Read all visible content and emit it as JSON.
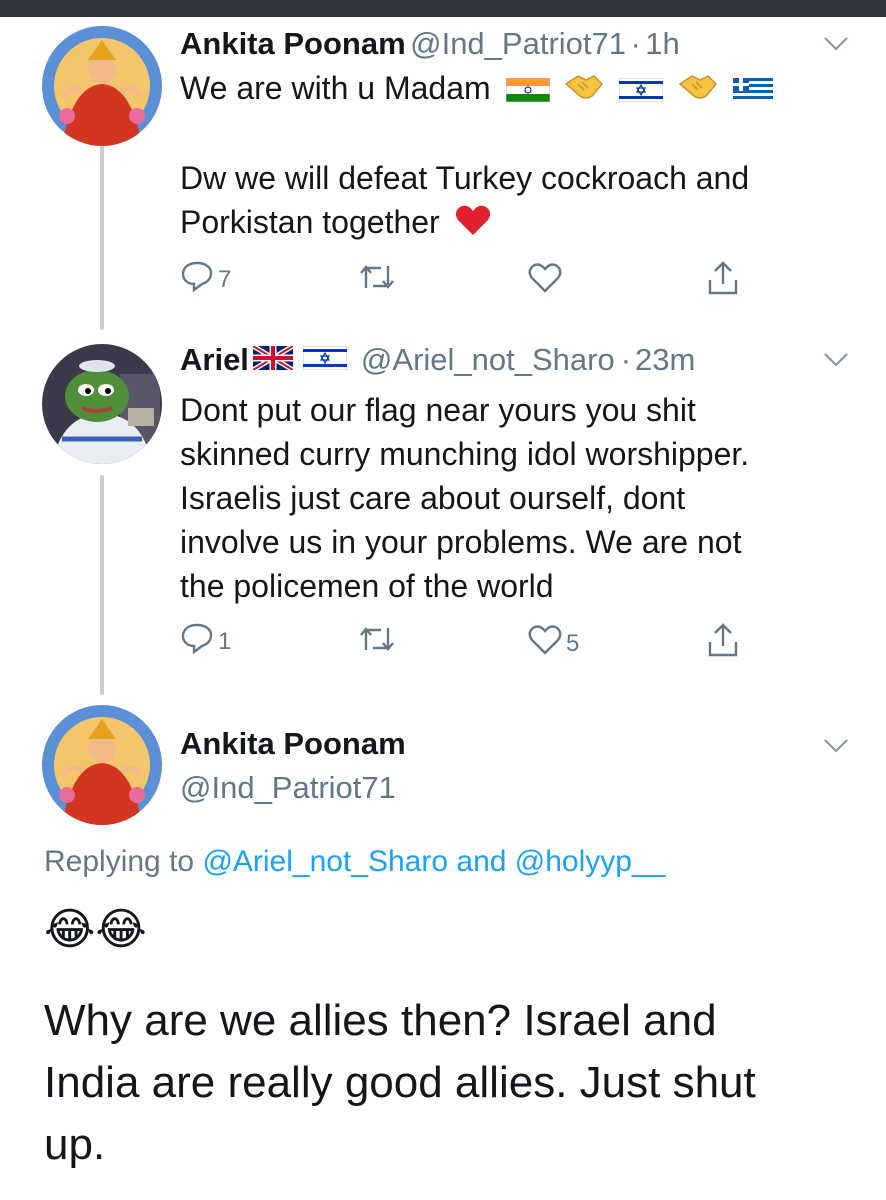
{
  "tweets": [
    {
      "display_name": "Ankita Poonam",
      "handle": "@Ind_Patriot71",
      "sep": "·",
      "time": "1h",
      "line1": "We are with u Madam",
      "line2": "Dw we will defeat Turkey cockroach and",
      "line3": "Porkistan together",
      "reply_count": "7",
      "retweet_count": "",
      "like_count": "",
      "icon": "heart-emoji"
    },
    {
      "display_name": "Ariel",
      "handle": "@Ariel_not_Sharo",
      "sep": "·",
      "time": "23m",
      "lines": [
        "Dont put our flag near yours you shit",
        "skinned curry munching idol worshipper.",
        "Israelis just care about ourself, dont",
        "involve us in your problems. We are not",
        "the policemen of the world"
      ],
      "reply_count": "1",
      "retweet_count": "",
      "like_count": "5"
    }
  ],
  "main_tweet": {
    "display_name": "Ankita Poonam",
    "handle": "@Ind_Patriot71",
    "replying_prefix": "Replying to",
    "replying_user1": "@Ariel_not_Sharo",
    "replying_and": "and",
    "replying_user2": "@holyyp__",
    "emoji": "😂😂",
    "lines": [
      "Why are we allies then? Israel and",
      "India are really good allies. Just shut",
      "up."
    ]
  },
  "colors": {
    "text": "#14171a",
    "secondary": "#657786",
    "link": "#1da1f2",
    "thread_line": "#c9cdd1",
    "heart": "#e0245e"
  }
}
